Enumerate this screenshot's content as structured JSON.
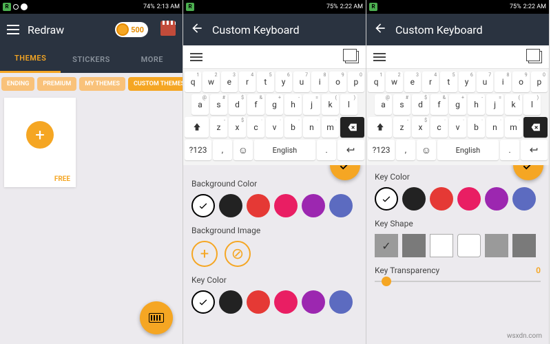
{
  "status": {
    "battery1": "74%",
    "time1": "2:13 AM",
    "battery2": "75%",
    "time2": "2:22 AM",
    "battery3": "75%",
    "time3": "2:22 AM"
  },
  "panel1": {
    "title": "Redraw",
    "coins": "500",
    "tabs": [
      "THEMES",
      "STICKERS",
      "MORE"
    ],
    "chips": [
      "ENDING",
      "PREMIUM",
      "MY THEMES",
      "CUSTOM THEMES"
    ],
    "card_price": "FREE"
  },
  "panel2": {
    "title": "Custom Keyboard",
    "rows": {
      "r1": [
        [
          "q",
          "1"
        ],
        [
          "w",
          "2"
        ],
        [
          "e",
          "3"
        ],
        [
          "r",
          "4"
        ],
        [
          "t",
          "5"
        ],
        [
          "y",
          "6"
        ],
        [
          "u",
          "7"
        ],
        [
          "i",
          "8"
        ],
        [
          "o",
          "9"
        ],
        [
          "p",
          "0"
        ]
      ],
      "r2": [
        [
          "a",
          "@"
        ],
        [
          "s",
          "#"
        ],
        [
          "d",
          "$"
        ],
        [
          "f",
          "&"
        ],
        [
          "g",
          "+"
        ],
        [
          "h",
          "-"
        ],
        [
          "j",
          "="
        ],
        [
          "k",
          "("
        ],
        [
          "l",
          ")"
        ]
      ],
      "r3": [
        [
          "z",
          "-"
        ],
        [
          "x",
          "$"
        ],
        [
          "c",
          "·"
        ],
        [
          "v",
          "·"
        ],
        [
          "b",
          "·"
        ],
        [
          "n",
          "·"
        ],
        [
          "m",
          "·"
        ]
      ],
      "r4_sym": "?123",
      "space": "English"
    },
    "sections": {
      "bg_color": "Background Color",
      "bg_image": "Background Image",
      "key_color": "Key Color"
    },
    "palette": [
      "#222222",
      "#e53935",
      "#e91e63",
      "#9c27b0",
      "#5c6bc0",
      "#3f51b5"
    ]
  },
  "panel3": {
    "title": "Custom Keyboard",
    "sections": {
      "key_color": "Key Color",
      "key_shape": "Key Shape",
      "key_trans": "Key Transparency"
    },
    "palette": [
      "#222222",
      "#e53935",
      "#e91e63",
      "#9c27b0",
      "#5c6bc0",
      "#3f51b5"
    ],
    "trans_value": "0"
  },
  "watermark": "wsxdn.com"
}
